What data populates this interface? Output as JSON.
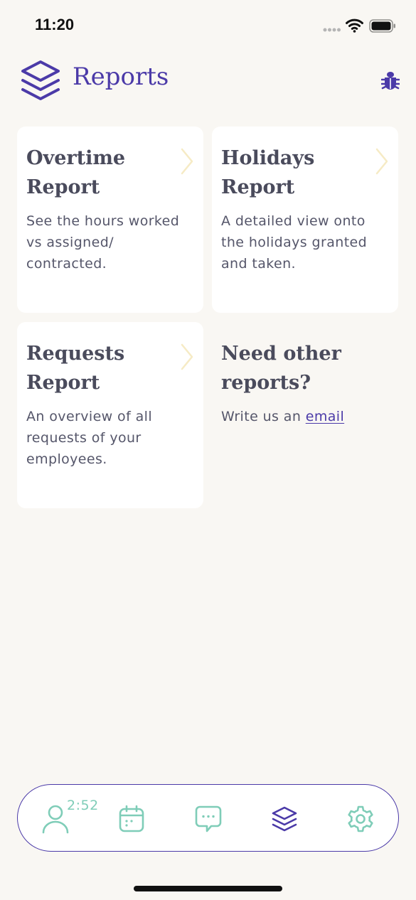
{
  "status_bar": {
    "time": "11:20"
  },
  "header": {
    "title": "Reports",
    "logo_icon": "layers-icon",
    "action_icon": "bug-icon"
  },
  "cards": [
    {
      "title": "Overtime Report",
      "description": "See the hours worked vs assigned/ contracted."
    },
    {
      "title": "Holidays Report",
      "description": "A detailed view onto the holidays granted and taken."
    },
    {
      "title": "Requests Report",
      "description": "An overview of all requests of your employees."
    }
  ],
  "other_reports": {
    "title": "Need other reports?",
    "text": "Write us an",
    "link_label": "email"
  },
  "tab_bar": {
    "timer": "2:52",
    "tabs": [
      {
        "icon": "user-icon"
      },
      {
        "icon": "calendar-icon"
      },
      {
        "icon": "chat-icon"
      },
      {
        "icon": "layers-icon",
        "active": true
      },
      {
        "icon": "gear-icon"
      }
    ]
  },
  "colors": {
    "accent": "#4b3aa8",
    "tab_inactive": "#7fcdb8",
    "chevron": "#f6ebc5",
    "background": "#f9f7f3",
    "card": "#ffffff",
    "text": "#4a4b5c"
  }
}
